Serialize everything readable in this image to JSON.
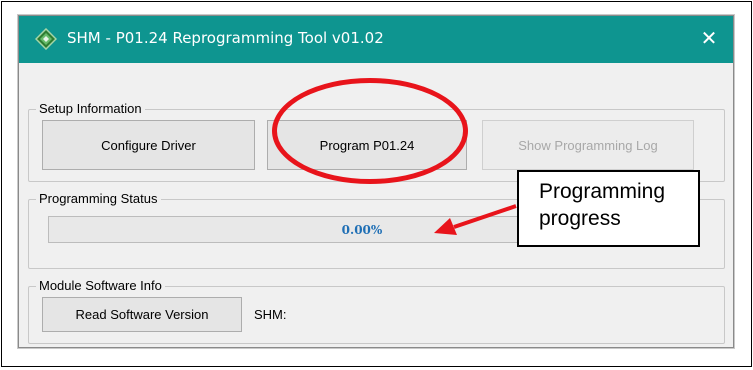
{
  "window": {
    "title": "SHM - P01.24 Reprogramming Tool v01.02",
    "close_glyph": "✕",
    "titlebar_color": "#0e9590"
  },
  "setup": {
    "group_label": "Setup Information",
    "configure_driver": "Configure Driver",
    "program": "Program P01.24",
    "show_log": "Show Programming Log"
  },
  "status": {
    "group_label": "Programming Status",
    "progress_text": "0.00%",
    "progress_fraction": 0.0
  },
  "module": {
    "group_label": "Module Software Info",
    "read_version": "Read Software Version",
    "shm_label": "SHM:"
  },
  "annotation": {
    "callout_line1": "Programming",
    "callout_line2": "progress",
    "highlight_color": "#e8141b"
  },
  "icons": {
    "app": "green-diamond-app-icon",
    "close": "close-icon"
  }
}
